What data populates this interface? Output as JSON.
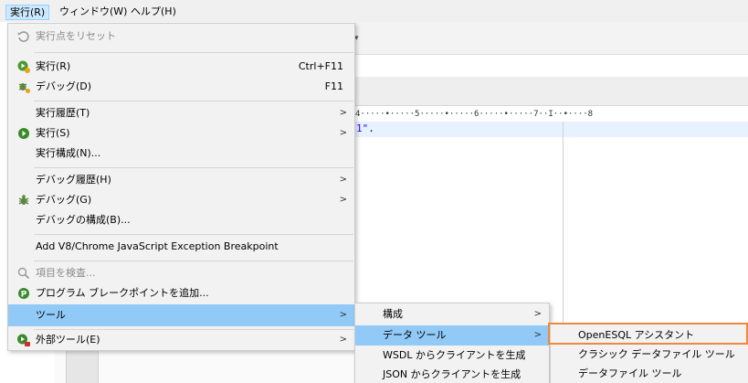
{
  "menubar": {
    "items": [
      {
        "label": "実行(R)"
      },
      {
        "label": "ウィンドウ(W)"
      },
      {
        "label": "ヘルプ(H)"
      }
    ]
  },
  "run_menu": {
    "reset_label": "実行点をリセット",
    "run_label": "実行(R)",
    "run_shortcut": "Ctrl+F11",
    "debug_label": "デバッグ(D)",
    "debug_shortcut": "F11",
    "run_history_label": "実行履歴(T)",
    "run_as_label": "実行(S)",
    "run_configs_label": "実行構成(N)...",
    "debug_history_label": "デバッグ履歴(H)",
    "debug_as_label": "デバッグ(G)",
    "debug_configs_label": "デバッグの構成(B)...",
    "add_exception_label": "Add V8/Chrome JavaScript Exception Breakpoint",
    "inspect_label": "項目を検査...",
    "add_breakpoint_label": "プログラム ブレークポイントを追加...",
    "tools_label": "ツール",
    "external_tools_label": "外部ツール(E)"
  },
  "tools_menu": {
    "config_label": "構成",
    "data_tools_label": "データ ツール",
    "wsdl_label": "WSDL からクライアントを生成",
    "json_label": "JSON からクライアントを生成"
  },
  "data_tools_menu": {
    "openesql_label": "OpenESQL アシスタント",
    "classic_label": "クラシック データファイル ツール",
    "datafile_label": "データファイル ツール"
  },
  "editor": {
    "ruler": "4·····•·····5·····•·····6·····•·····7··I··•····8",
    "code_text": "1\"",
    "code_punct": "."
  },
  "colors": {
    "highlight": "#91c9f7",
    "callout": "#f0883e",
    "menu_bg": "#f2f2f2"
  }
}
